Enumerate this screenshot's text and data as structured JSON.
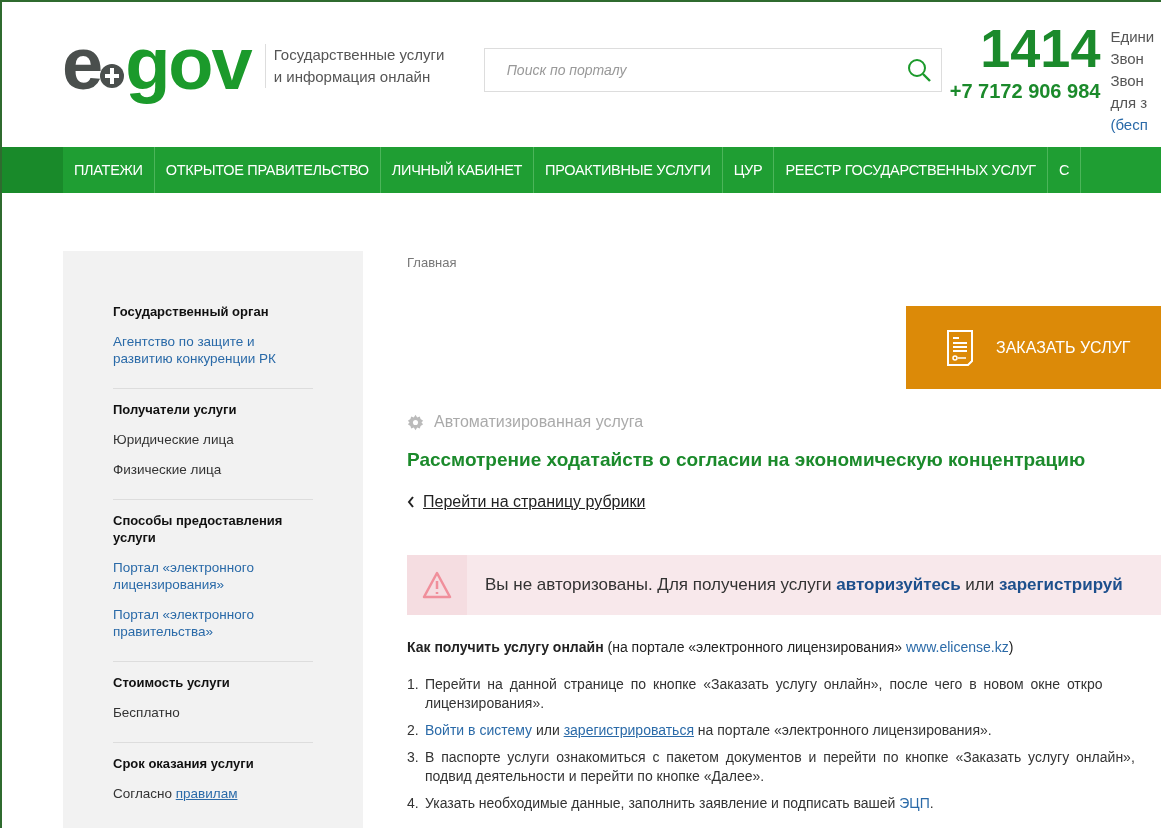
{
  "header": {
    "logo": {
      "left": "e",
      "right": "gov"
    },
    "tagline": [
      "Государственные услуги",
      "и информация онлайн"
    ],
    "search": {
      "placeholder": "Поиск по порталу"
    },
    "phone_short": "1414",
    "phone_long": "+7 7172 906 984",
    "info_lines": [
      "Едини",
      "Звон",
      "Звон",
      "для з"
    ],
    "info_link": "(бесп"
  },
  "nav": [
    {
      "label": "ПЛАТЕЖИ"
    },
    {
      "label": "ОТКРЫТОЕ ПРАВИТЕЛЬСТВО"
    },
    {
      "label": "ЛИЧНЫЙ КАБИНЕТ"
    },
    {
      "label": "ПРОАКТИВНЫЕ УСЛУГИ"
    },
    {
      "label": "ЦУР"
    },
    {
      "label": "РЕЕСТР ГОСУДАРСТВЕННЫХ УСЛУГ"
    },
    {
      "label": "С"
    }
  ],
  "sidebar": [
    {
      "title": "Государственный орган",
      "items": [
        [
          {
            "kind": "link",
            "text": "Агентство по защите и развитию конкуренции РК"
          }
        ]
      ]
    },
    {
      "title": "Получатели услуги",
      "items": [
        [
          {
            "kind": "text",
            "text": "Юридические лица"
          }
        ],
        [
          {
            "kind": "text",
            "text": "Физические лица"
          }
        ]
      ]
    },
    {
      "title": "Способы предоставления услуги",
      "items": [
        [
          {
            "kind": "link",
            "text": "Портал «электронного лицензирования»"
          }
        ],
        [
          {
            "kind": "link",
            "text": "Портал «электронного правительства»"
          }
        ]
      ]
    },
    {
      "title": "Стоимость услуги",
      "items": [
        [
          {
            "kind": "text",
            "text": "Бесплатно"
          }
        ]
      ]
    },
    {
      "title": "Срок оказания услуги",
      "items": [
        [
          {
            "kind": "text",
            "text": "Согласно "
          },
          {
            "kind": "underlined",
            "text": "правилам"
          }
        ]
      ]
    }
  ],
  "breadcrumb": "Главная",
  "order_button": "ЗАКАЗАТЬ УСЛУГ",
  "service_type": "Автоматизированная услуга",
  "title": "Рассмотрение ходатайств о согласии на экономическую концентрацию",
  "back_link": "Перейти на страницу рубрики",
  "alert": [
    {
      "kind": "text",
      "text": "Вы не авторизованы. Для получения услуги "
    },
    {
      "kind": "bold-link",
      "text": "авторизуйтесь"
    },
    {
      "kind": "text",
      "text": " или "
    },
    {
      "kind": "bold-link",
      "text": "зарегистрируй"
    }
  ],
  "howto": [
    {
      "kind": "bold",
      "text": "Как получить услугу онлайн"
    },
    {
      "kind": "text",
      "text": "  (на портале «электронного лицензирования» "
    },
    {
      "kind": "link",
      "text": "www.elicense.kz"
    },
    {
      "kind": "text",
      "text": ")"
    }
  ],
  "steps": [
    {
      "number": "1.",
      "lines": [
        [
          {
            "kind": "text",
            "text": "Перейти на данной странице по кнопке «Заказать услугу онлайн», после чего в новом окне откро"
          }
        ],
        [
          {
            "kind": "text",
            "text": "лицензирования»."
          }
        ]
      ]
    },
    {
      "number": "2.",
      "lines": [
        [
          {
            "kind": "link",
            "text": "Войти в систему"
          },
          {
            "kind": "text",
            "text": " или "
          },
          {
            "kind": "underlined",
            "text": "зарегистрироваться"
          },
          {
            "kind": "text",
            "text": " на портале «электронного лицензирования»."
          }
        ]
      ]
    },
    {
      "number": "3.",
      "lines": [
        [
          {
            "kind": "text",
            "text": "В паспорте услуги ознакомиться с пакетом документов и перейти по кнопке «Заказать услугу онлайн»,"
          }
        ],
        [
          {
            "kind": "text",
            "text": "подвид деятельности и перейти по кнопке «Далее»."
          }
        ]
      ]
    },
    {
      "number": "4.",
      "lines": [
        [
          {
            "kind": "text",
            "text": "Указать необходимые данные, заполнить заявление и подписать вашей "
          },
          {
            "kind": "link",
            "text": "ЭЦП"
          },
          {
            "kind": "text",
            "text": "."
          }
        ]
      ]
    }
  ]
}
